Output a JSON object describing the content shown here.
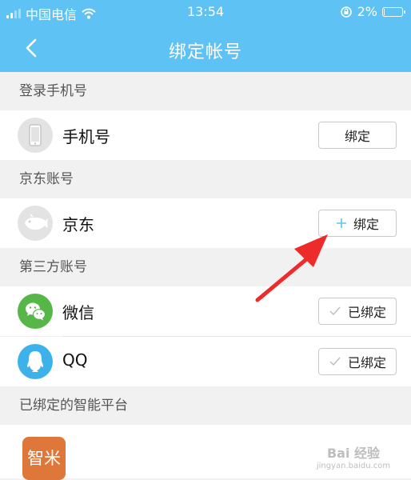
{
  "status_bar": {
    "carrier": "中国电信",
    "time": "13:54",
    "battery": "2%",
    "battery_level": 0.02
  },
  "header": {
    "back_icon": "chevron-left-icon",
    "title": "绑定帐号"
  },
  "sections": {
    "phone": {
      "header": "登录手机号",
      "item": {
        "label": "手机号",
        "button": "绑定",
        "icon": "phone-icon"
      }
    },
    "jd": {
      "header": "京东账号",
      "item": {
        "label": "京东",
        "button": "绑定",
        "button_icon": "plus-icon",
        "icon": "jd-dog-icon"
      }
    },
    "third_party": {
      "header": "第三方账号",
      "items": [
        {
          "label": "微信",
          "button": "已绑定",
          "button_icon": "check-icon",
          "icon": "wechat-icon"
        },
        {
          "label": "QQ",
          "button": "已绑定",
          "button_icon": "check-icon",
          "icon": "qq-penguin-icon"
        }
      ]
    },
    "smart_platforms": {
      "header": "已绑定的智能平台",
      "items": [
        {
          "icon_text": "智米"
        }
      ]
    }
  },
  "watermark": {
    "text": "Bai 经验",
    "url": "jingyan.baidu.com"
  },
  "colors": {
    "accent": "#5ec3f4",
    "wechat": "#56b647",
    "qq": "#3db2ea",
    "zhimi": "#e0773a",
    "arrow": "#ee2b2b"
  }
}
